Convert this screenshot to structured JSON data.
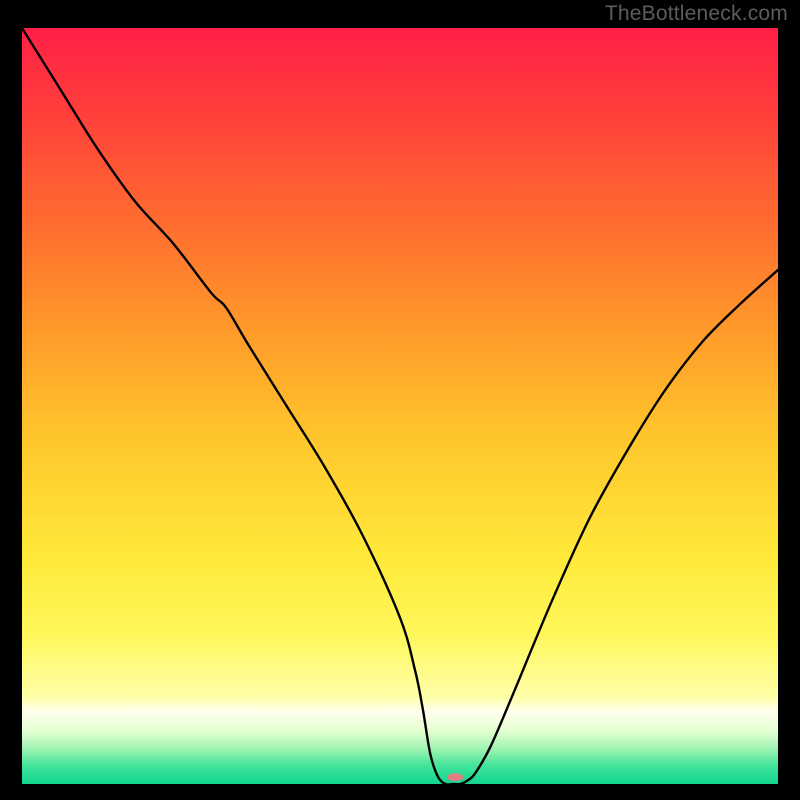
{
  "watermark": "TheBottleneck.com",
  "chart_data": {
    "type": "line",
    "title": "",
    "xlabel": "",
    "ylabel": "",
    "xlim": [
      0,
      100
    ],
    "ylim": [
      0,
      100
    ],
    "series": [
      {
        "name": "curve",
        "x": [
          0,
          5,
          10,
          15,
          20,
          25,
          27,
          30,
          35,
          40,
          45,
          50,
          52,
          53,
          54,
          55,
          56,
          57,
          58,
          59,
          60,
          62,
          65,
          70,
          75,
          80,
          85,
          90,
          95,
          100
        ],
        "y": [
          100,
          92,
          84,
          77,
          71.5,
          65,
          63,
          58,
          50,
          42,
          33,
          22,
          15,
          10,
          4,
          1,
          0,
          0,
          0,
          0.5,
          1.5,
          5,
          12,
          24,
          35,
          44,
          52,
          58.5,
          63.5,
          68
        ]
      }
    ],
    "marker": {
      "x": 57.3,
      "y": 0.9,
      "color": "#e37f82",
      "rx": 8,
      "ry": 4
    },
    "gradient_stops": [
      {
        "offset": 0.0,
        "color": "#ff1f47"
      },
      {
        "offset": 0.1,
        "color": "#ff3b3c"
      },
      {
        "offset": 0.25,
        "color": "#ff6a30"
      },
      {
        "offset": 0.4,
        "color": "#ff9a2a"
      },
      {
        "offset": 0.55,
        "color": "#ffc82c"
      },
      {
        "offset": 0.7,
        "color": "#ffe93a"
      },
      {
        "offset": 0.8,
        "color": "#fff75a"
      },
      {
        "offset": 0.885,
        "color": "#ffffa8"
      },
      {
        "offset": 0.905,
        "color": "#ffffef"
      },
      {
        "offset": 0.93,
        "color": "#e3ffd0"
      },
      {
        "offset": 0.955,
        "color": "#9af2b0"
      },
      {
        "offset": 0.975,
        "color": "#45e49a"
      },
      {
        "offset": 1.0,
        "color": "#11d58f"
      }
    ]
  }
}
